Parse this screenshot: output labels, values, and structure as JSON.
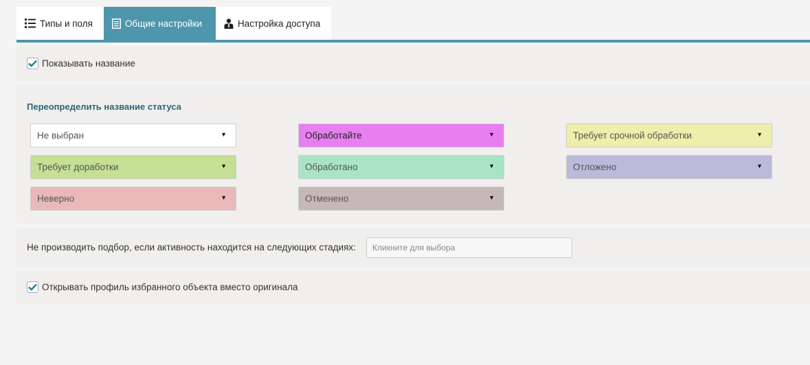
{
  "tabs": [
    {
      "label": "Типы и поля",
      "icon": "list-icon",
      "active": false
    },
    {
      "label": "Общие настройки",
      "icon": "document-icon",
      "active": true
    },
    {
      "label": "Настройка доступа",
      "icon": "user-access-icon",
      "active": false
    }
  ],
  "show_name": {
    "label": "Показывать название",
    "checked": true
  },
  "status_override": {
    "title": "Переопределить название статуса",
    "options": [
      {
        "label": "Не выбран",
        "color": "#ffffff"
      },
      {
        "label": "Обработайте",
        "color": "#e87ff0"
      },
      {
        "label": "Требует срочной обработки",
        "color": "#efeeaa"
      },
      {
        "label": "Требует доработки",
        "color": "#c5df94"
      },
      {
        "label": "Обработано",
        "color": "#a9e5c4"
      },
      {
        "label": "Отложено",
        "color": "#bbbadb"
      },
      {
        "label": "Неверно",
        "color": "#e9b9b9"
      },
      {
        "label": "Отменено",
        "color": "#c7b8b8"
      }
    ]
  },
  "skip_selection": {
    "label": "Не производить подбор, если активность находится на следующих стадиях:",
    "placeholder": "Кликните для выбора"
  },
  "open_profile": {
    "label": "Открывать профиль избранного объекта вместо оригинала",
    "checked": true
  },
  "colors": {
    "accent": "#4d96ac",
    "panel": "#f0efed",
    "title": "#2a6478"
  }
}
